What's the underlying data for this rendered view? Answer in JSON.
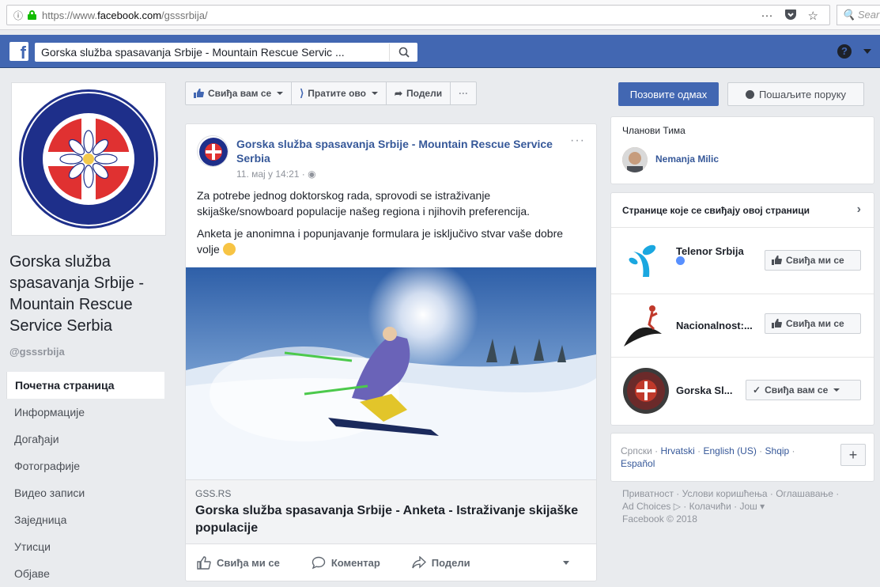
{
  "browser": {
    "url_prefix": "https://www.",
    "url_domain": "facebook.com",
    "url_path": "/gsssrbija/",
    "more_icon": "···",
    "search_placeholder": "Sear"
  },
  "fb_header": {
    "search_value": "Gorska služba spasavanja Srbije - Mountain Rescue Servic ..."
  },
  "page": {
    "name": "Gorska služba spasavanja Srbije - Mountain Rescue Service Serbia",
    "handle": "@gsssrbija"
  },
  "left_nav": [
    {
      "label": "Почетна страница",
      "active": true
    },
    {
      "label": "Информације"
    },
    {
      "label": "Догађаји"
    },
    {
      "label": "Фотографије"
    },
    {
      "label": "Видео записи"
    },
    {
      "label": "Заједница"
    },
    {
      "label": "Утисци"
    },
    {
      "label": "Објаве"
    }
  ],
  "action_bar": {
    "like": "Свиђа вам се",
    "follow": "Пратите ово",
    "share": "Подели",
    "more": "···"
  },
  "call_button": "Позовите одмах",
  "message_button": "Пошаљите поруку",
  "post": {
    "author": "Gorska služba spasavanja Srbije - Mountain Rescue Service Serbia",
    "time": "11. мај у 14:21 · ",
    "more": "···",
    "paragraph1": "Za potrebe jednog doktorskog rada, sprovodi se istraživanje skijaške/snowboard populacije našeg regiona i njihovih preferencija.",
    "paragraph2": "Anketa je anonimna i popunjavanje formulara je isključivo stvar vaše dobre volje ",
    "link_domain": "GSS.RS",
    "link_title": "Gorska služba spasavanja Srbije - Anketa - Istraživanje skijaške populacije",
    "action_like": "Свиђа ми се",
    "action_comment": "Коментар",
    "action_share": "Подели"
  },
  "team": {
    "header": "Чланови Тима",
    "member": "Nemanja Milic"
  },
  "liked_pages": {
    "header": "Странице које се свиђају овој страници",
    "items": [
      {
        "name": "Telenor Srbija",
        "button": "Свиђа ми се"
      },
      {
        "name": "Nacionalnost:...",
        "button": "Свиђа ми се"
      },
      {
        "name": "Gorska Sl...",
        "button": "Свиђа вам се"
      }
    ]
  },
  "languages": {
    "lang1": "Српски",
    "lang2": "Hrvatski",
    "lang3": "English (US)",
    "lang4": "Shqip",
    "lang5": "Español",
    "sep": " · "
  },
  "footer": {
    "privacy": "Приватност",
    "terms": "Услови коришћења",
    "advertising": "Оглашавање",
    "adchoices": "Ad Choices",
    "cookies": "Колачићи",
    "more": "Још",
    "copyright": "Facebook © 2018"
  },
  "colors": {
    "fb_blue": "#4267b2",
    "link": "#365899",
    "background": "#e9ebee"
  }
}
